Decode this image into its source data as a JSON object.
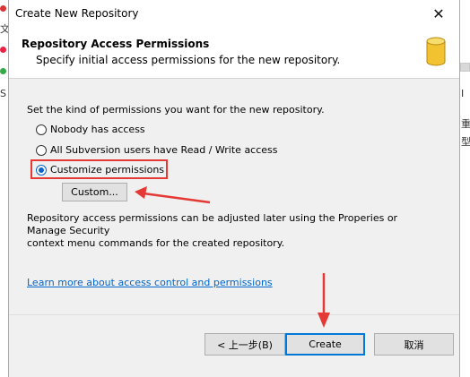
{
  "window": {
    "title": "Create New Repository"
  },
  "header": {
    "title": "Repository Access Permissions",
    "subtitle": "Specify initial access permissions for the new repository."
  },
  "content": {
    "intro": "Set the kind of permissions you want for the new repository.",
    "options": [
      {
        "label": "Nobody has access",
        "checked": false
      },
      {
        "label": "All Subversion users have Read / Write access",
        "checked": false
      },
      {
        "label": "Customize permissions",
        "checked": true
      }
    ],
    "custom_button": "Custom...",
    "note_line1": "Repository access permissions can be adjusted later using the Properies or Manage Security",
    "note_line2": "context menu commands for the created repository.",
    "link": "Learn more about access control and permissions"
  },
  "footer": {
    "back_label": "< 上一步(B)",
    "create_label": "Create",
    "cancel_label": "取消"
  },
  "background": {
    "left_fragments": [
      "文",
      "S"
    ],
    "right_fragments": [
      "I",
      "重",
      "型"
    ]
  },
  "colors": {
    "accent": "#0078d7",
    "annotation_red": "#e53935",
    "link": "#0066cc",
    "db_icon": "#e8b520"
  },
  "icons": {
    "close": "close-icon",
    "database": "database-icon"
  }
}
